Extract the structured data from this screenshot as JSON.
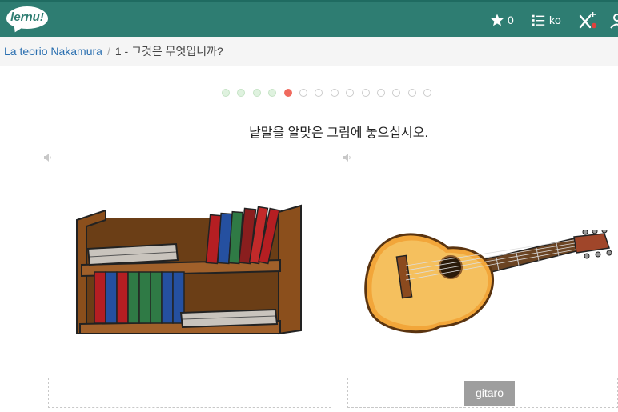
{
  "header": {
    "logo_text": "lernu!",
    "stars_count": "0",
    "language_code": "ko",
    "icons": [
      "star-icon",
      "list-icon",
      "close-x-icon",
      "user-icon"
    ],
    "color": "#2e7d72"
  },
  "breadcrumb": {
    "course": "La teorio Nakamura",
    "separator": "/",
    "lesson": "1 - 그것은 무엇입니까?"
  },
  "progress": {
    "completed": 4,
    "current": 5,
    "total": 14
  },
  "exercise": {
    "instruction": "낱말을 알맞은 그림에 놓으십시오.",
    "cards": [
      {
        "picture": "bookshelf",
        "audio_icon": "speaker-icon",
        "answer": ""
      },
      {
        "picture": "guitar",
        "audio_icon": "speaker-icon",
        "answer": "gitaro"
      }
    ]
  }
}
